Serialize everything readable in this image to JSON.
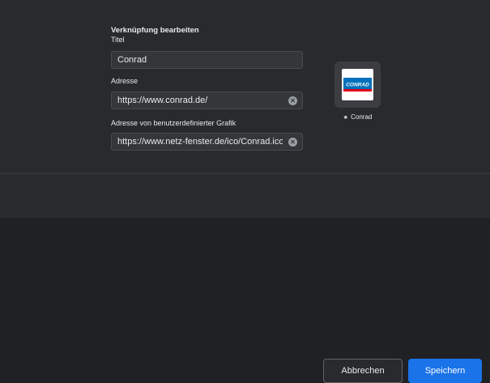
{
  "dialog": {
    "title": "Verknüpfung bearbeiten",
    "fields": {
      "titel": {
        "label": "Titel",
        "value": "Conrad"
      },
      "adresse": {
        "label": "Adresse",
        "value": "https://www.conrad.de/"
      },
      "grafik": {
        "label": "Adresse von benutzerdefinierter Grafik",
        "value": "https://www.netz-fenster.de/ico/Conrad.ico"
      }
    },
    "preview": {
      "logo_text": "CONRAD",
      "caption": "Conrad",
      "caption_icon": "★"
    },
    "buttons": {
      "cancel": "Abbrechen",
      "save": "Speichern"
    },
    "clear_icon": "✕"
  },
  "colors": {
    "background": "#292a2d",
    "field": "#35363a",
    "accent": "#1a73e8",
    "conrad_blue": "#0072bc"
  }
}
